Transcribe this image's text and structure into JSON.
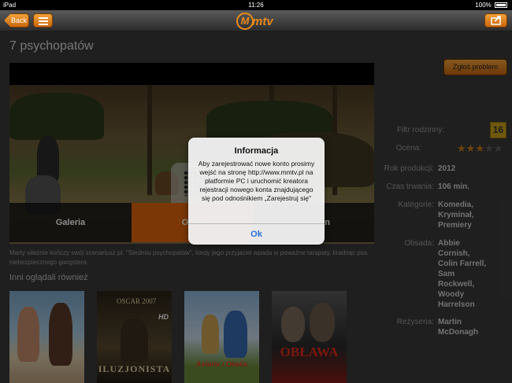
{
  "status_bar": {
    "device": "iPad",
    "time": "11:26",
    "battery": "100%"
  },
  "nav": {
    "back_label": "Back",
    "logo_letter": "M",
    "logo_text": "mtv"
  },
  "movie": {
    "title": "7 psychopatów",
    "report_button": "Zgłoś problem",
    "tabs": [
      "Galeria",
      "Odtw",
      "an"
    ],
    "description": "Marty właśnie kończy swój scenariusz pt. \"Siedmiu psychopatów\", kiedy jego przyjaciel wpada w poważne tarapaty, kradnąc psa niebezpiecznego gangstera."
  },
  "info": {
    "family_filter_label": "Filtr rodzinny:",
    "age_rating": "16",
    "rating_label": "Ocena:",
    "rating_value": 3,
    "rating_max": 5,
    "year_label": "Rok produkcji:",
    "year": "2012",
    "duration_label": "Czas trwania:",
    "duration": "106 min.",
    "categories_label": "Kategorie:",
    "categories": [
      "Komedia,",
      "Kryminał,",
      "Premiery"
    ],
    "cast_label": "Obsada:",
    "cast": [
      "Abbie",
      "Cornish,",
      "Colin Farrell,",
      "Sam",
      "Rockwell,",
      "Woody",
      "Harrelson"
    ],
    "director_label": "Reżyseria:",
    "director": [
      "Martin",
      "McDonagh"
    ]
  },
  "also_watched": {
    "title": "Inni oglądali również",
    "posters": [
      "",
      "ILUZJONISTA",
      "Asterix i Obelix",
      "OBŁAWA"
    ]
  },
  "dialog": {
    "title": "Informacja",
    "message": "Aby zarejestrować nowe konto prosimy wejść na stronę http://www.mmtv.pl na platformie PC i uruchomić kreatora rejestracji nowego konta znajdującego się pod odnośnikiem „Zarejestruj się\"",
    "ok_label": "Ok"
  },
  "colors": {
    "accent": "#e0650c",
    "star_on": "#c77a1b",
    "dialog_button": "#2a6fd8"
  }
}
